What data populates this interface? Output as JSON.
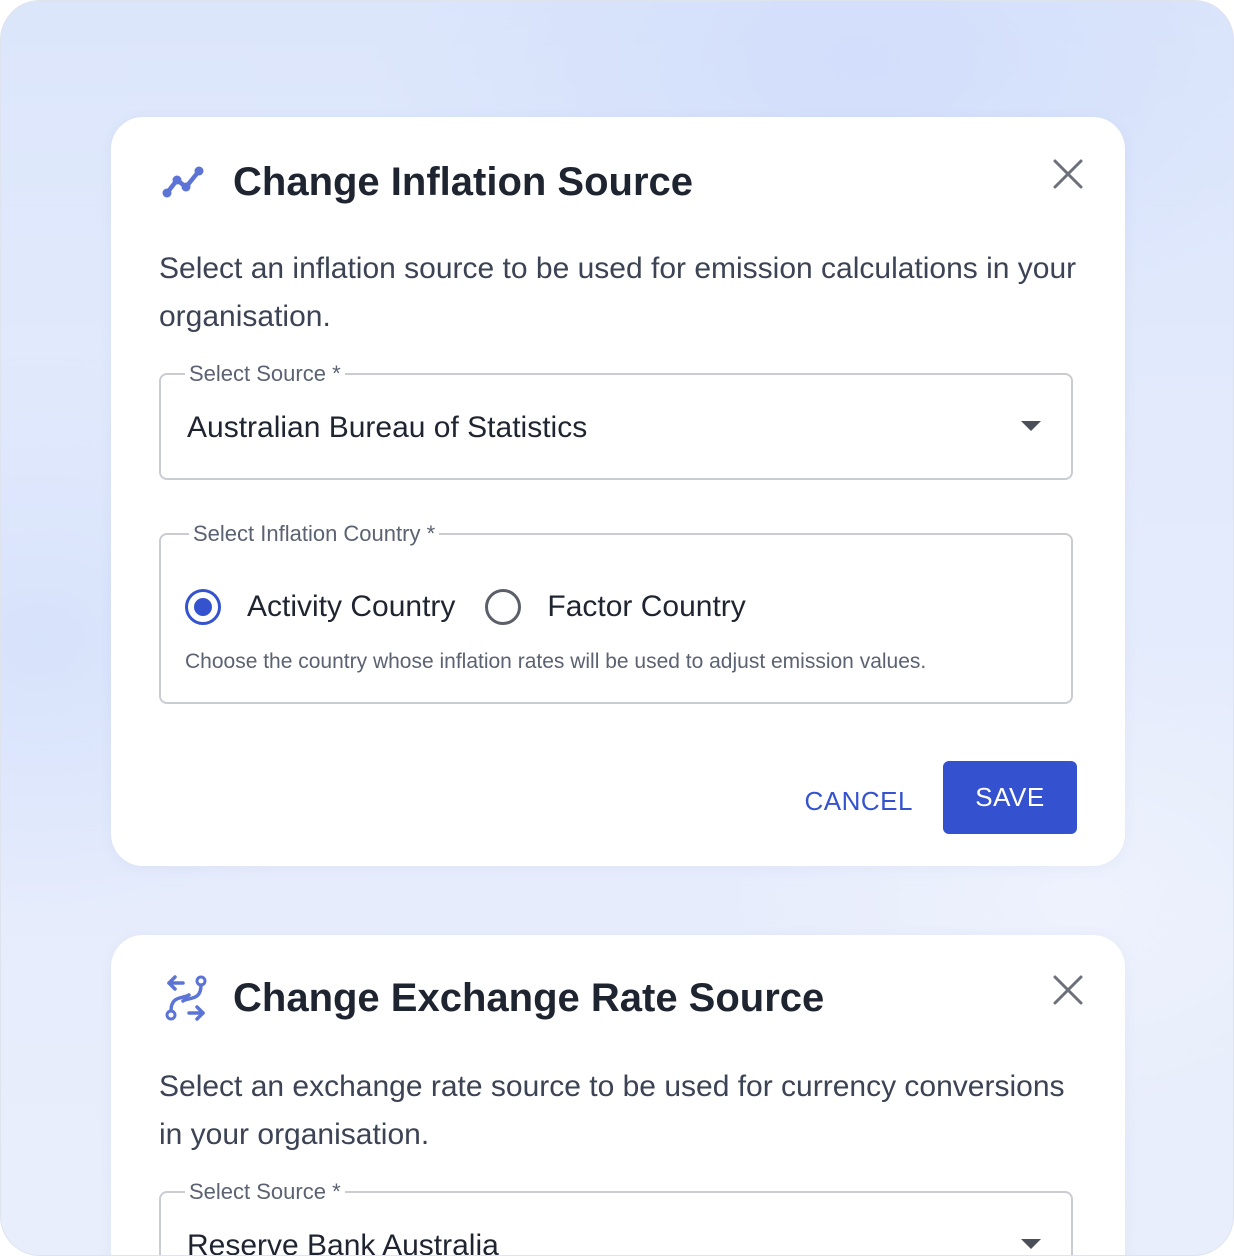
{
  "inflation_dialog": {
    "title": "Change Inflation Source",
    "icon": "trend-line-icon",
    "description": "Select an inflation source to be used for emission calculations in your organisation.",
    "source_field": {
      "label": "Select Source *",
      "value": "Australian Bureau of Statistics"
    },
    "country_group": {
      "label": "Select Inflation Country *",
      "options": [
        {
          "label": "Activity Country",
          "selected": true
        },
        {
          "label": "Factor Country",
          "selected": false
        }
      ],
      "helper": "Choose the country whose inflation rates will be used to adjust emission values."
    },
    "cancel_label": "CANCEL",
    "save_label": "SAVE"
  },
  "exchange_dialog": {
    "title": "Change Exchange Rate Source",
    "icon": "exchange-arrows-icon",
    "description": "Select an exchange rate source to be used for currency conversions in your organisation.",
    "source_field": {
      "label": "Select Source *",
      "value": "Reserve Bank Australia"
    }
  },
  "colors": {
    "accent": "#3452d0",
    "icon": "#5b74d6",
    "title_text": "#1f2431",
    "body_text": "#3b4354",
    "border": "#c9ccd3"
  }
}
